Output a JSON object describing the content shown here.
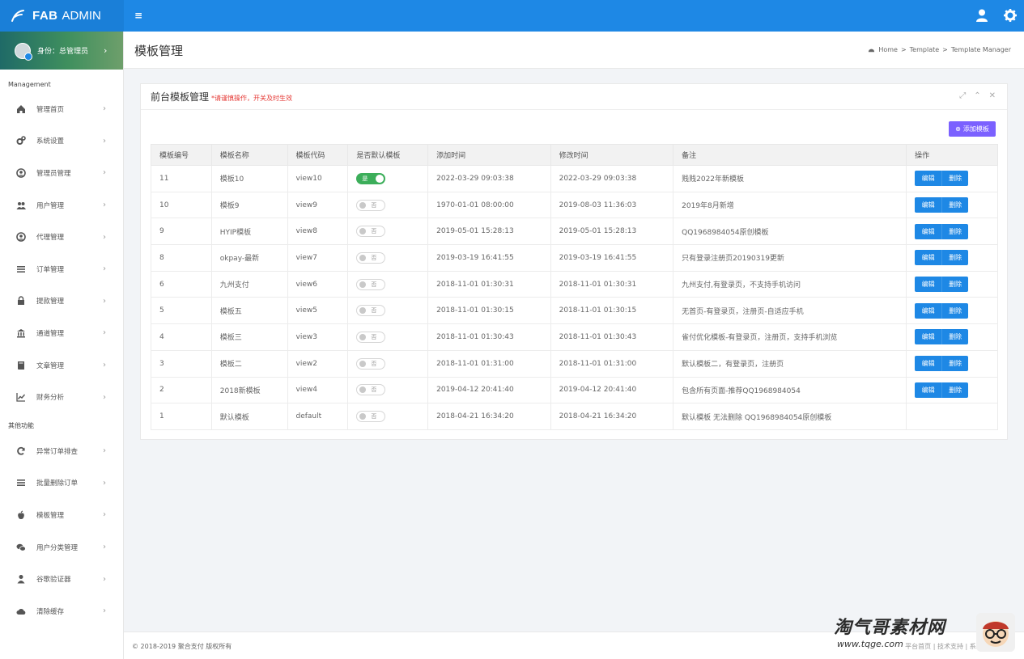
{
  "brand": {
    "name_bold": "FAB",
    "name_light": "ADMIN"
  },
  "profile": {
    "label": "身份：总管理员",
    "chevron": "›"
  },
  "sidebar": {
    "section1": "Management",
    "items1": [
      {
        "label": "管理首页",
        "icon": "home-icon"
      },
      {
        "label": "系统设置",
        "icon": "cogs-icon"
      },
      {
        "label": "管理员管理",
        "icon": "user-circle-icon"
      },
      {
        "label": "用户管理",
        "icon": "users-icon"
      },
      {
        "label": "代理管理",
        "icon": "user-circle-icon"
      },
      {
        "label": "订单管理",
        "icon": "list-icon"
      },
      {
        "label": "提款管理",
        "icon": "lock-icon"
      },
      {
        "label": "通道管理",
        "icon": "bank-icon"
      },
      {
        "label": "文章管理",
        "icon": "book-icon"
      },
      {
        "label": "财务分析",
        "icon": "line-chart-icon"
      }
    ],
    "section2": "其他功能",
    "items2": [
      {
        "label": "异常订单排查",
        "icon": "refresh-icon"
      },
      {
        "label": "批量删除订单",
        "icon": "list-icon"
      },
      {
        "label": "模板管理",
        "icon": "apple-icon"
      },
      {
        "label": "用户分类管理",
        "icon": "wechat-icon"
      },
      {
        "label": "谷歌验证器",
        "icon": "user-icon"
      },
      {
        "label": "清除缓存",
        "icon": "cloud-icon"
      }
    ]
  },
  "header": {
    "title": "模板管理",
    "breadcrumb": [
      "Home",
      ">",
      "Template",
      ">",
      "Template Manager"
    ]
  },
  "panel": {
    "title": "前台模板管理",
    "note": "*请谨慎操作，开关及时生效",
    "add_button": "添加模板"
  },
  "table": {
    "headers": [
      "模板编号",
      "模板名称",
      "模板代码",
      "是否默认模板",
      "添加时间",
      "修改时间",
      "备注",
      "操作"
    ],
    "rows": [
      {
        "id": "11",
        "name": "模板10",
        "code": "view10",
        "default": true,
        "switch": "是",
        "added": "2022-03-29 09:03:38",
        "modified": "2022-03-29 09:03:38",
        "note": "贱贱2022年新模板",
        "ops": true
      },
      {
        "id": "10",
        "name": "模板9",
        "code": "view9",
        "default": false,
        "switch": "否",
        "added": "1970-01-01 08:00:00",
        "modified": "2019-08-03 11:36:03",
        "note": "2019年8月新增",
        "ops": true
      },
      {
        "id": "9",
        "name": "HYIP模板",
        "code": "view8",
        "default": false,
        "switch": "否",
        "added": "2019-05-01 15:28:13",
        "modified": "2019-05-01 15:28:13",
        "note": "QQ1968984054原创模板",
        "ops": true
      },
      {
        "id": "8",
        "name": "okpay-最新",
        "code": "view7",
        "default": false,
        "switch": "否",
        "added": "2019-03-19 16:41:55",
        "modified": "2019-03-19 16:41:55",
        "note": "只有登录注册页20190319更新",
        "ops": true
      },
      {
        "id": "6",
        "name": "九州支付",
        "code": "view6",
        "default": false,
        "switch": "否",
        "added": "2018-11-01 01:30:31",
        "modified": "2018-11-01 01:30:31",
        "note": "九州支付,有登录页，不支持手机访问",
        "ops": true
      },
      {
        "id": "5",
        "name": "模板五",
        "code": "view5",
        "default": false,
        "switch": "否",
        "added": "2018-11-01 01:30:15",
        "modified": "2018-11-01 01:30:15",
        "note": "无首页-有登录页，注册页-自适应手机",
        "ops": true
      },
      {
        "id": "4",
        "name": "模板三",
        "code": "view3",
        "default": false,
        "switch": "否",
        "added": "2018-11-01 01:30:43",
        "modified": "2018-11-01 01:30:43",
        "note": "雀付优化模板-有登录页，注册页，支持手机浏览",
        "ops": true
      },
      {
        "id": "3",
        "name": "模板二",
        "code": "view2",
        "default": false,
        "switch": "否",
        "added": "2018-11-01 01:31:00",
        "modified": "2018-11-01 01:31:00",
        "note": "默认模板二，有登录页，注册页",
        "ops": true
      },
      {
        "id": "2",
        "name": "2018新模板",
        "code": "view4",
        "default": false,
        "switch": "否",
        "added": "2019-04-12 20:41:40",
        "modified": "2019-04-12 20:41:40",
        "note": "包含所有页面-推荐QQ1968984054",
        "ops": true
      },
      {
        "id": "1",
        "name": "默认模板",
        "code": "default",
        "default": false,
        "switch": "否",
        "added": "2018-04-21 16:34:20",
        "modified": "2018-04-21 16:34:20",
        "note": "默认模板 无法删除 QQ1968984054原创模板",
        "ops": false
      }
    ],
    "edit_label": "编辑",
    "delete_label": "删除"
  },
  "footer": {
    "copyright": "© 2018-2019 聚合支付 版权所有",
    "links": "平台首页 | 技术支持 | 系统版本 3.0"
  },
  "watermark": {
    "text": "淘气哥素材网",
    "url": "www.tqge.com"
  },
  "colors": {
    "primary": "#1e88e5",
    "accent": "#7b61ff",
    "switch_on": "#3cae5a",
    "note_red": "#e53935"
  }
}
